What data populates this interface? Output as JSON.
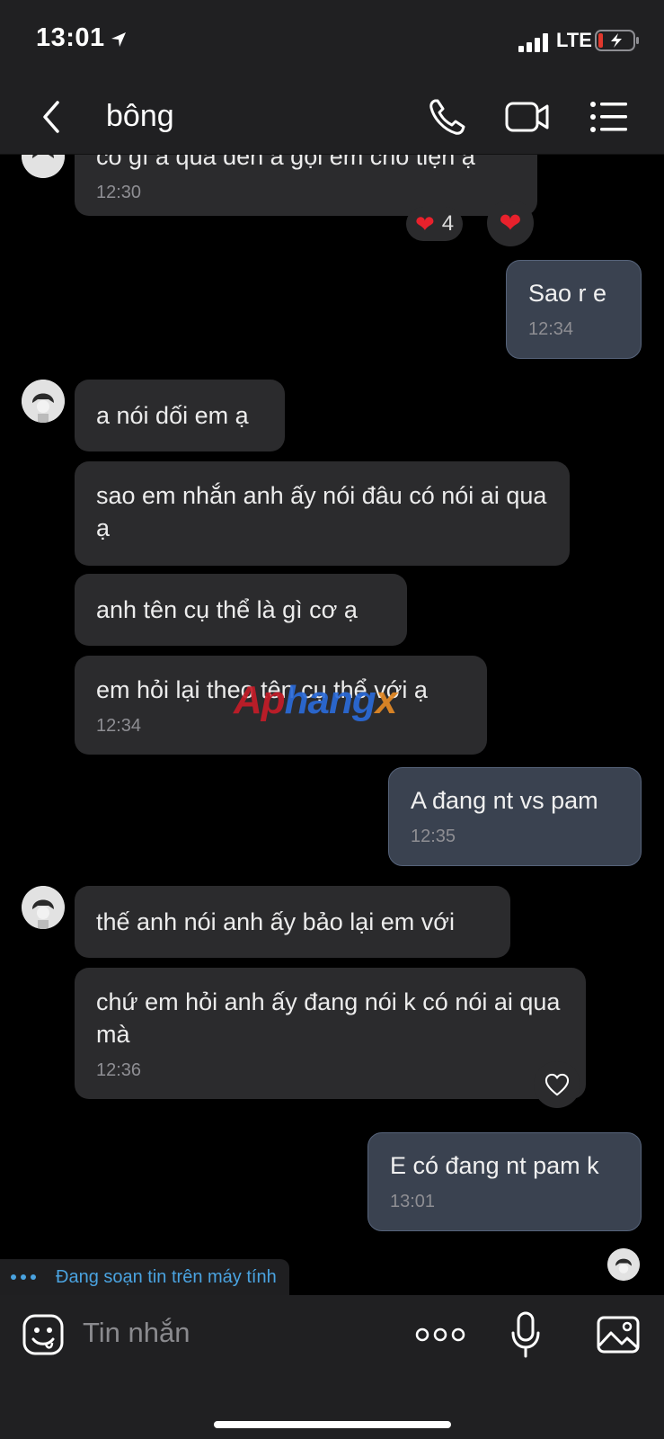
{
  "status_bar": {
    "time": "13:01",
    "network": "LTE"
  },
  "header": {
    "title": "bông"
  },
  "messages": [
    {
      "dir": "in",
      "text": "có gì a qua đến a gọi em cho tiện ạ",
      "time": "12:30"
    },
    {
      "dir": "out",
      "text": "Sao r e",
      "time": "12:34"
    },
    {
      "dir": "in",
      "text": "a nói dối em ạ"
    },
    {
      "dir": "in",
      "text": "sao em nhắn anh ấy nói đâu có nói ai qua ạ"
    },
    {
      "dir": "in",
      "text": "anh tên cụ thể là gì cơ ạ"
    },
    {
      "dir": "in",
      "text": "em hỏi lại theo tên cụ thể với ạ",
      "time": "12:34"
    },
    {
      "dir": "out",
      "text": "A đang nt vs pam",
      "time": "12:35"
    },
    {
      "dir": "in",
      "text": "thế anh nói anh ấy bảo lại em với"
    },
    {
      "dir": "in",
      "text": "chứ em hỏi anh ấy đang nói k có nói ai qua mà",
      "time": "12:36"
    },
    {
      "dir": "out",
      "text": "E có đang nt pam k",
      "time": "13:01"
    }
  ],
  "reactions": {
    "heart_count": "4",
    "heart_icon": "heart-emoji",
    "add_icon": "heart-outline-icon"
  },
  "watermark": {
    "part1": "Ap",
    "part2": "hang",
    "part3": "x"
  },
  "typing_indicator": "Đang soạn tin trên máy tính",
  "input": {
    "placeholder": "Tin nhắn"
  },
  "colors": {
    "incoming_bubble": "#2b2b2d",
    "outgoing_bubble": "#3a4250",
    "outgoing_border": "#56637a",
    "typing_text": "#4aa3e0",
    "bar_bg": "#202022"
  }
}
